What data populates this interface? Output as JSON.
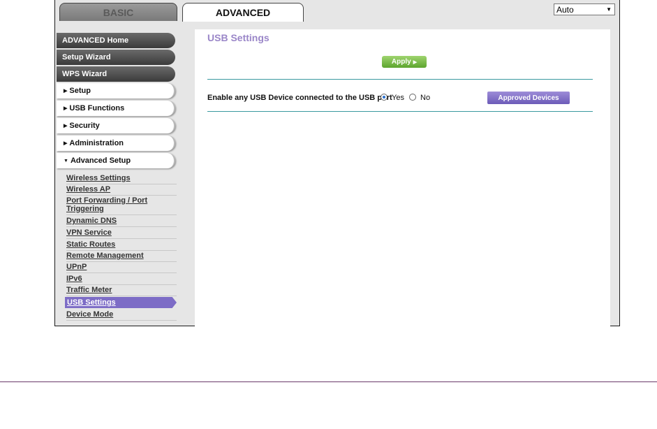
{
  "tabs": {
    "basic": "BASIC",
    "advanced": "ADVANCED"
  },
  "language_select": {
    "value": "Auto"
  },
  "sidebar": {
    "main_buttons": [
      "ADVANCED Home",
      "Setup Wizard",
      "WPS Wizard"
    ],
    "sections": [
      "Setup",
      "USB Functions",
      "Security",
      "Administration",
      "Advanced Setup"
    ],
    "advanced_setup_items": [
      "Wireless Settings",
      "Wireless AP",
      "Port Forwarding / Port Triggering",
      "Dynamic DNS",
      "VPN Service",
      "Static Routes",
      "Remote Management",
      "UPnP",
      "IPv6",
      "Traffic Meter",
      "USB Settings",
      "Device Mode"
    ]
  },
  "content": {
    "title": "USB Settings",
    "apply_label": "Apply",
    "usb_enable_label": "Enable any USB Device connected to the USB port",
    "yes_label": "Yes",
    "no_label": "No",
    "selected": "Yes",
    "approved_devices_label": "Approved Devices"
  },
  "colors": {
    "accent": "#7d6cc6",
    "apply_green": "#6cb33f",
    "divider": "#3a9aa0"
  }
}
